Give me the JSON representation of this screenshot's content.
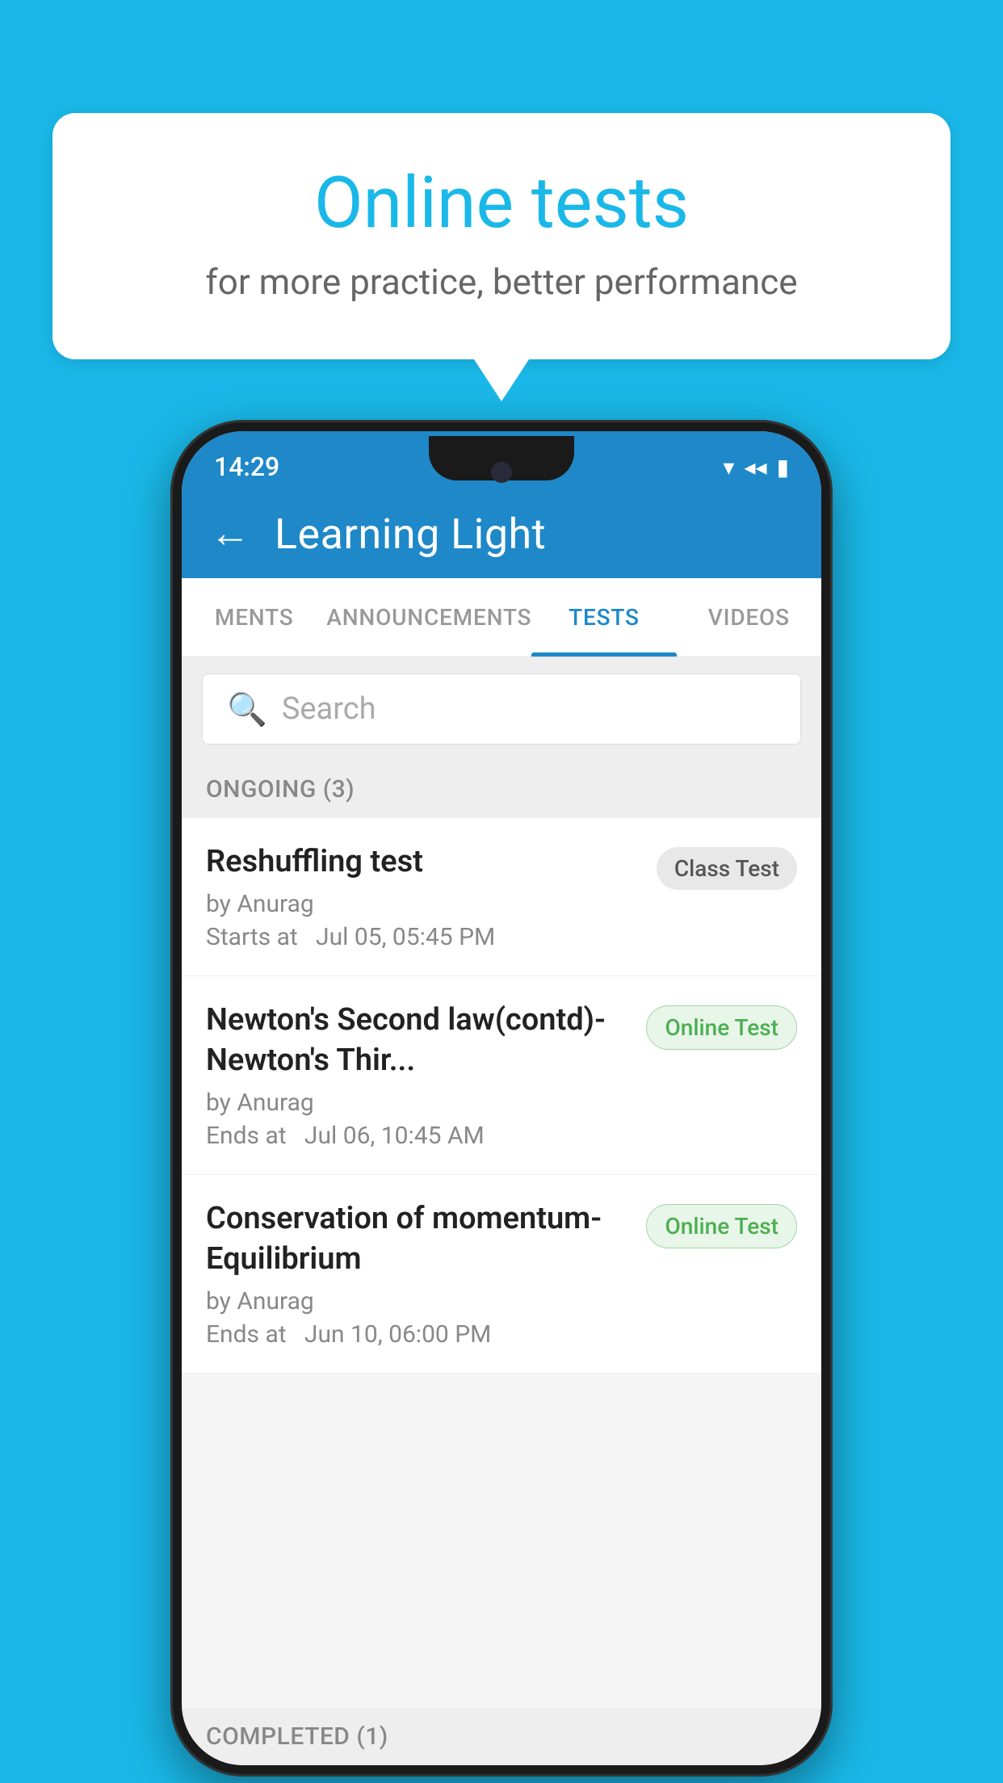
{
  "background": {
    "color": "#1ab8e8"
  },
  "bubble": {
    "title": "Online tests",
    "subtitle": "for more practice, better performance"
  },
  "phone": {
    "status_bar": {
      "time": "14:29",
      "icons": [
        "wifi",
        "signal",
        "battery"
      ]
    },
    "header": {
      "title": "Learning Light",
      "back_label": "←"
    },
    "tabs": [
      {
        "label": "MENTS",
        "active": false
      },
      {
        "label": "ANNOUNCEMENTS",
        "active": false
      },
      {
        "label": "TESTS",
        "active": true
      },
      {
        "label": "VIDEOS",
        "active": false
      }
    ],
    "search": {
      "placeholder": "Search"
    },
    "ongoing": {
      "section_label": "ONGOING (3)",
      "tests": [
        {
          "name": "Reshuffling test",
          "by": "by Anurag",
          "date": "Starts at  Jul 05, 05:45 PM",
          "badge": "Class Test",
          "badge_type": "class"
        },
        {
          "name": "Newton's Second law(contd)-Newton's Thir...",
          "by": "by Anurag",
          "date": "Ends at  Jul 06, 10:45 AM",
          "badge": "Online Test",
          "badge_type": "online"
        },
        {
          "name": "Conservation of momentum-Equilibrium",
          "by": "by Anurag",
          "date": "Ends at  Jun 10, 06:00 PM",
          "badge": "Online Test",
          "badge_type": "online"
        }
      ]
    },
    "completed": {
      "section_label": "COMPLETED (1)"
    }
  }
}
